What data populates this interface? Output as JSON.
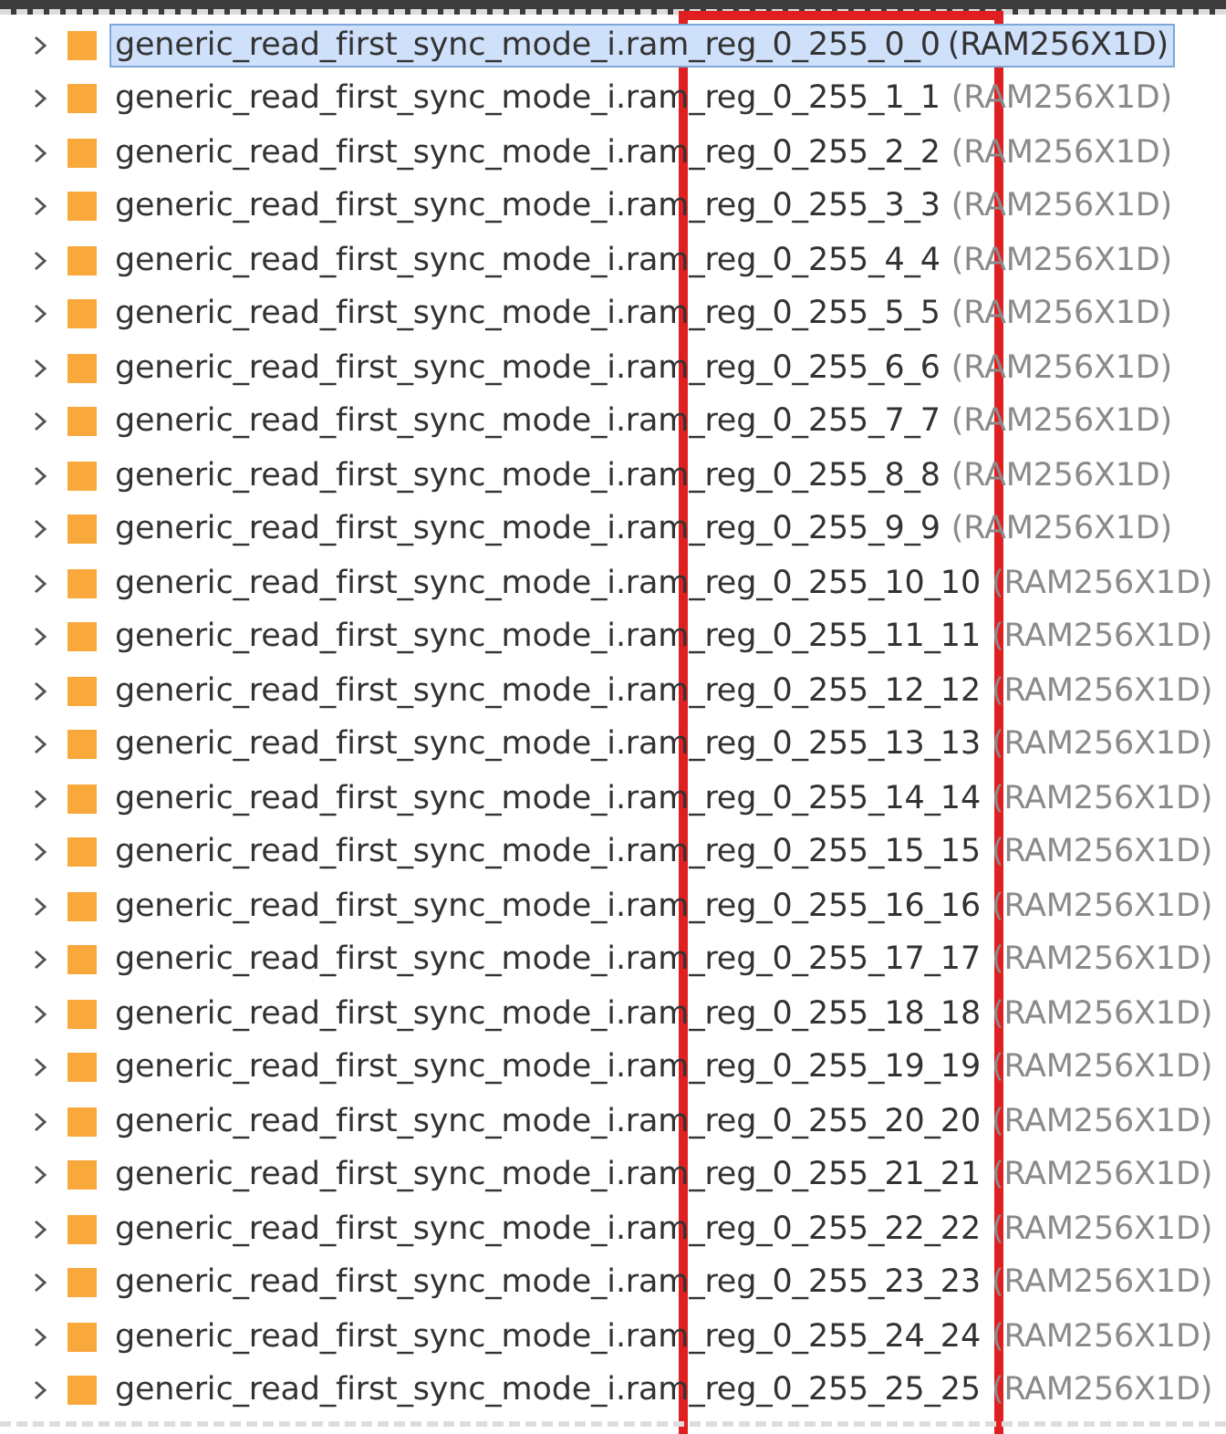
{
  "tree": {
    "items": [
      {
        "name": "generic_read_first_sync_mode_i.ram_reg_0_255_0_0",
        "type": "(RAM256X1D)",
        "selected": true,
        "expanded": false
      },
      {
        "name": "generic_read_first_sync_mode_i.ram_reg_0_255_1_1",
        "type": "(RAM256X1D)",
        "selected": false,
        "expanded": false
      },
      {
        "name": "generic_read_first_sync_mode_i.ram_reg_0_255_2_2",
        "type": "(RAM256X1D)",
        "selected": false,
        "expanded": false
      },
      {
        "name": "generic_read_first_sync_mode_i.ram_reg_0_255_3_3",
        "type": "(RAM256X1D)",
        "selected": false,
        "expanded": false
      },
      {
        "name": "generic_read_first_sync_mode_i.ram_reg_0_255_4_4",
        "type": "(RAM256X1D)",
        "selected": false,
        "expanded": false
      },
      {
        "name": "generic_read_first_sync_mode_i.ram_reg_0_255_5_5",
        "type": "(RAM256X1D)",
        "selected": false,
        "expanded": false
      },
      {
        "name": "generic_read_first_sync_mode_i.ram_reg_0_255_6_6",
        "type": "(RAM256X1D)",
        "selected": false,
        "expanded": false
      },
      {
        "name": "generic_read_first_sync_mode_i.ram_reg_0_255_7_7",
        "type": "(RAM256X1D)",
        "selected": false,
        "expanded": false
      },
      {
        "name": "generic_read_first_sync_mode_i.ram_reg_0_255_8_8",
        "type": "(RAM256X1D)",
        "selected": false,
        "expanded": false
      },
      {
        "name": "generic_read_first_sync_mode_i.ram_reg_0_255_9_9",
        "type": "(RAM256X1D)",
        "selected": false,
        "expanded": false
      },
      {
        "name": "generic_read_first_sync_mode_i.ram_reg_0_255_10_10",
        "type": "(RAM256X1D)",
        "selected": false,
        "expanded": false
      },
      {
        "name": "generic_read_first_sync_mode_i.ram_reg_0_255_11_11",
        "type": "(RAM256X1D)",
        "selected": false,
        "expanded": false
      },
      {
        "name": "generic_read_first_sync_mode_i.ram_reg_0_255_12_12",
        "type": "(RAM256X1D)",
        "selected": false,
        "expanded": false
      },
      {
        "name": "generic_read_first_sync_mode_i.ram_reg_0_255_13_13",
        "type": "(RAM256X1D)",
        "selected": false,
        "expanded": false
      },
      {
        "name": "generic_read_first_sync_mode_i.ram_reg_0_255_14_14",
        "type": "(RAM256X1D)",
        "selected": false,
        "expanded": false
      },
      {
        "name": "generic_read_first_sync_mode_i.ram_reg_0_255_15_15",
        "type": "(RAM256X1D)",
        "selected": false,
        "expanded": false
      },
      {
        "name": "generic_read_first_sync_mode_i.ram_reg_0_255_16_16",
        "type": "(RAM256X1D)",
        "selected": false,
        "expanded": false
      },
      {
        "name": "generic_read_first_sync_mode_i.ram_reg_0_255_17_17",
        "type": "(RAM256X1D)",
        "selected": false,
        "expanded": false
      },
      {
        "name": "generic_read_first_sync_mode_i.ram_reg_0_255_18_18",
        "type": "(RAM256X1D)",
        "selected": false,
        "expanded": false
      },
      {
        "name": "generic_read_first_sync_mode_i.ram_reg_0_255_19_19",
        "type": "(RAM256X1D)",
        "selected": false,
        "expanded": false
      },
      {
        "name": "generic_read_first_sync_mode_i.ram_reg_0_255_20_20",
        "type": "(RAM256X1D)",
        "selected": false,
        "expanded": false
      },
      {
        "name": "generic_read_first_sync_mode_i.ram_reg_0_255_21_21",
        "type": "(RAM256X1D)",
        "selected": false,
        "expanded": false
      },
      {
        "name": "generic_read_first_sync_mode_i.ram_reg_0_255_22_22",
        "type": "(RAM256X1D)",
        "selected": false,
        "expanded": false
      },
      {
        "name": "generic_read_first_sync_mode_i.ram_reg_0_255_23_23",
        "type": "(RAM256X1D)",
        "selected": false,
        "expanded": false
      },
      {
        "name": "generic_read_first_sync_mode_i.ram_reg_0_255_24_24",
        "type": "(RAM256X1D)",
        "selected": false,
        "expanded": false
      },
      {
        "name": "generic_read_first_sync_mode_i.ram_reg_0_255_25_25",
        "type": "(RAM256X1D)",
        "selected": false,
        "expanded": false
      }
    ]
  }
}
